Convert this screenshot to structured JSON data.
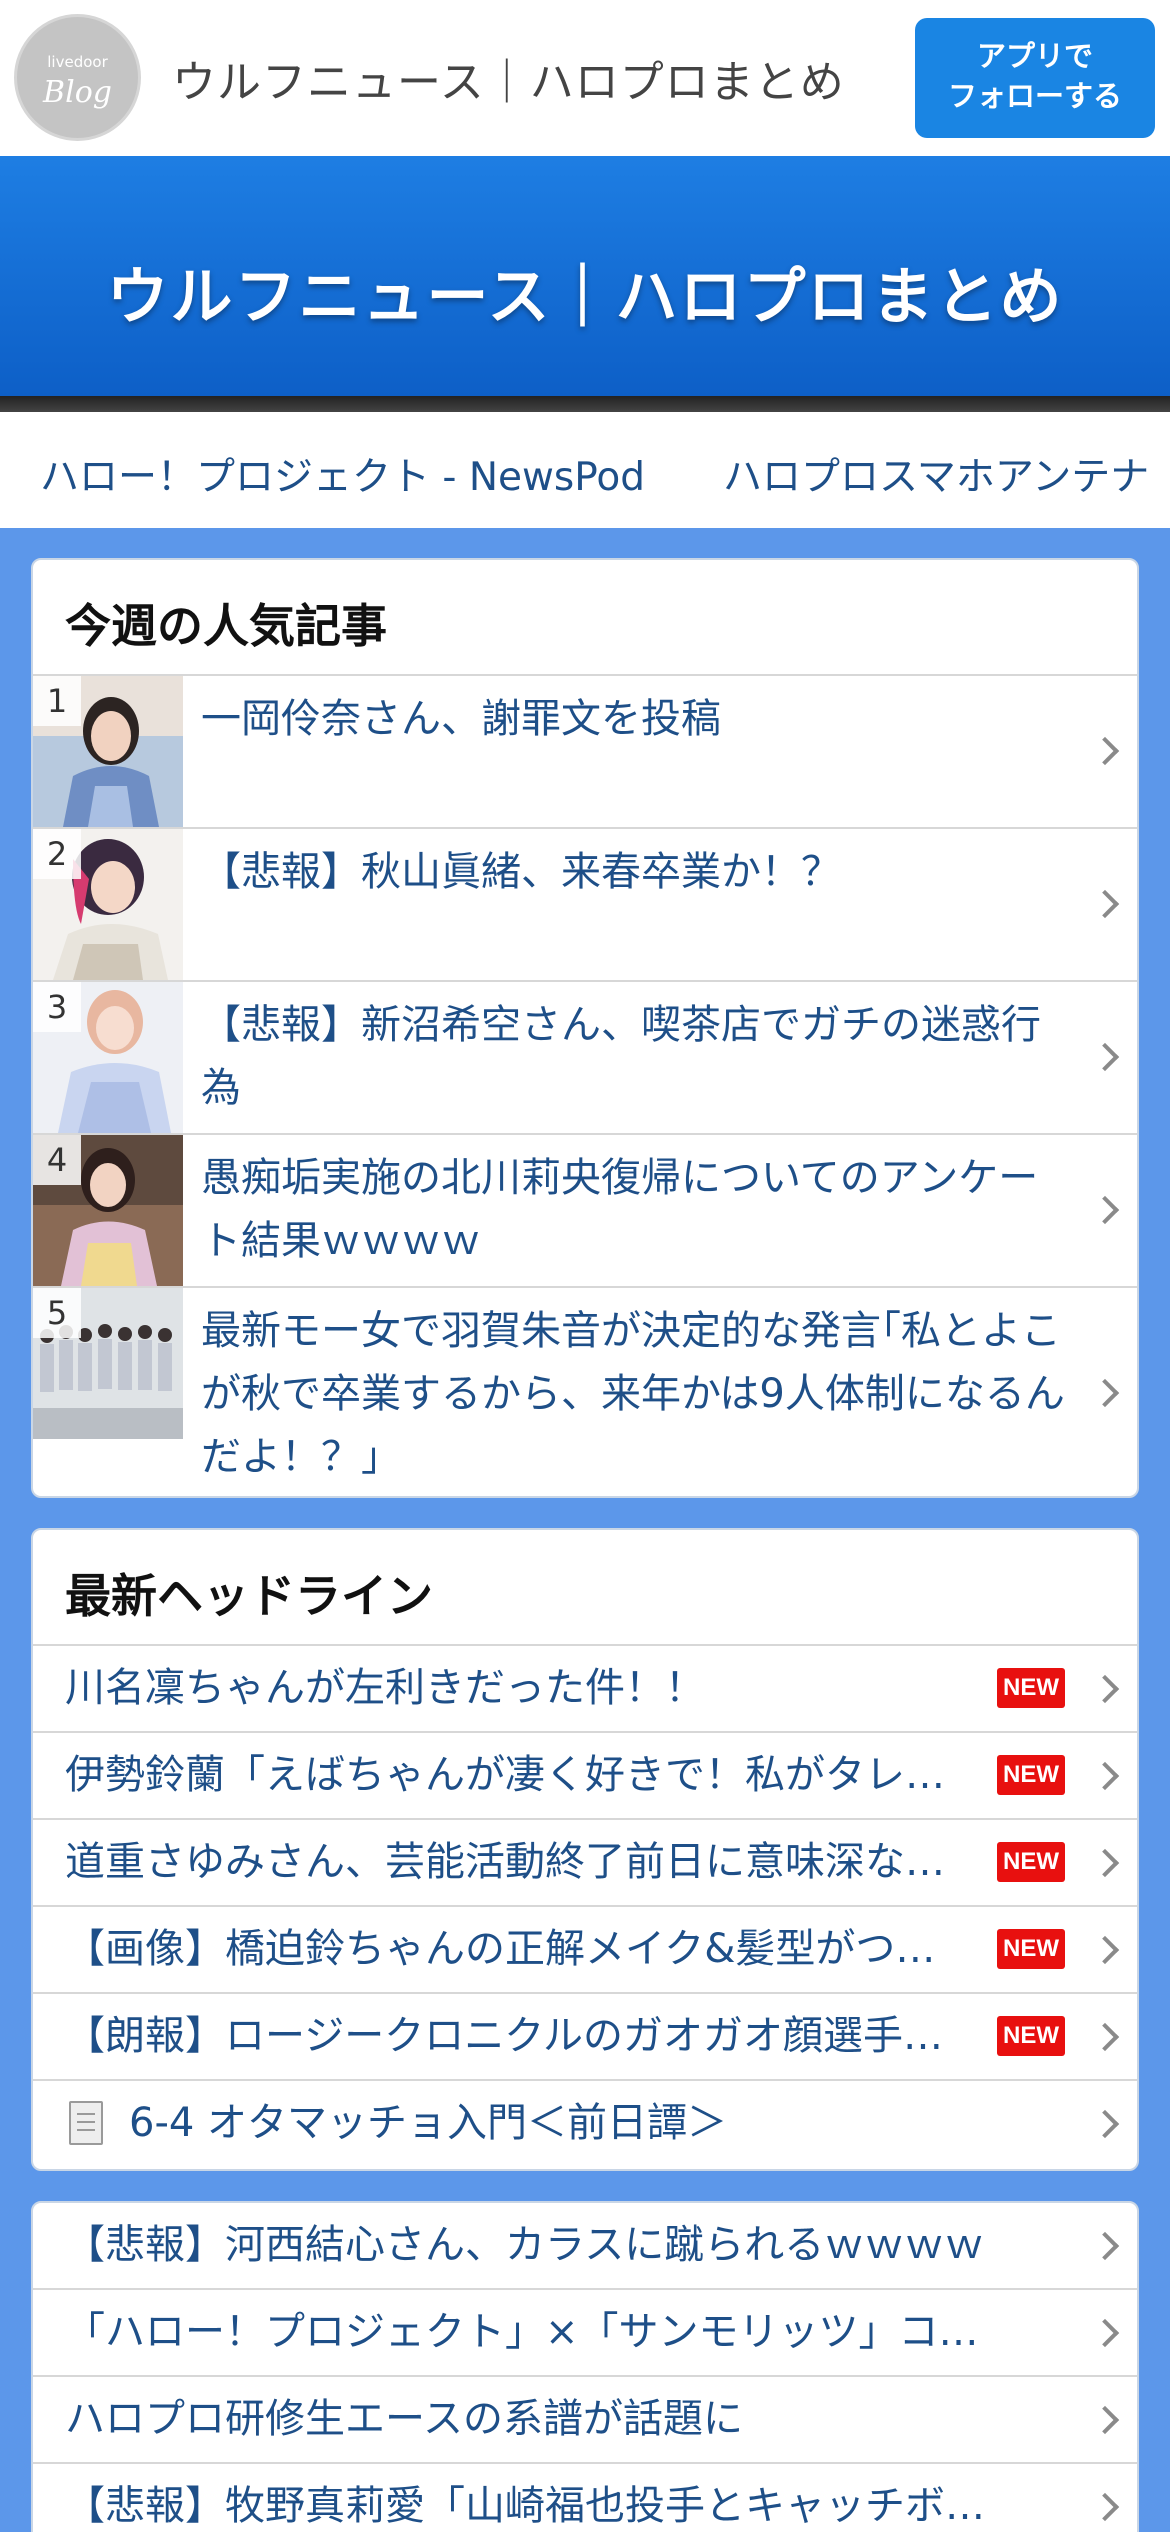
{
  "topbar": {
    "logo_small": "livedoor",
    "logo_big": "Blog",
    "title": "ウルフニュース｜ハロプロまとめ",
    "follow_line1": "アプリで",
    "follow_line2": "フォローする"
  },
  "hero": {
    "title": "ウルフニュース｜ハロプロまとめ"
  },
  "links": [
    "ハロー！プロジェクト - NewsPod",
    "ハロプロスマホアンテナ"
  ],
  "popular": {
    "heading": "今週の人気記事",
    "items": [
      {
        "rank": "1",
        "title": "一岡伶奈さん、謝罪文を投稿"
      },
      {
        "rank": "2",
        "title": "【悲報】秋山眞緒、来春卒業か！？"
      },
      {
        "rank": "3",
        "title": "【悲報】新沼希空さん、喫茶店でガチの迷惑行為"
      },
      {
        "rank": "4",
        "title": "愚痴垢実施の北川莉央復帰についてのアンケート結果ｗｗｗｗ"
      },
      {
        "rank": "5",
        "title": "最新モー女で羽賀朱音が決定的な発言｢私とよこが秋で卒業するから、来年かは9人体制になるんだよ！？｣"
      }
    ]
  },
  "headlines": {
    "heading": "最新ヘッドライン",
    "new_label": "NEW",
    "items": [
      "川名凜ちゃんが左利きだった件！！",
      "伊勢鈴蘭「えばちゃんが凄く好きで！私がタレ…",
      "道重さゆみさん、芸能活動終了前日に意味深な…",
      "【画像】橋迫鈴ちゃんの正解メイク&髪型がつ…",
      "【朗報】ロージークロニクルのガオガオ顔選手…",
      "6-4 オタマッチョ入門＜前日譚＞"
    ]
  },
  "more": {
    "items": [
      "【悲報】河西結心さん、カラスに蹴られるｗｗｗｗ",
      "「ハロー！プロジェクト」×「サンモリッツ」コ…",
      "ハロプロ研修生エースの系譜が話題に",
      "【悲報】牧野真莉愛「山崎福也投手とキャッチボ…"
    ]
  },
  "colors": {
    "accent": "#1a85e3",
    "link": "#1e4f88",
    "background": "#5c97ea",
    "new_badge": "#e8100f"
  }
}
